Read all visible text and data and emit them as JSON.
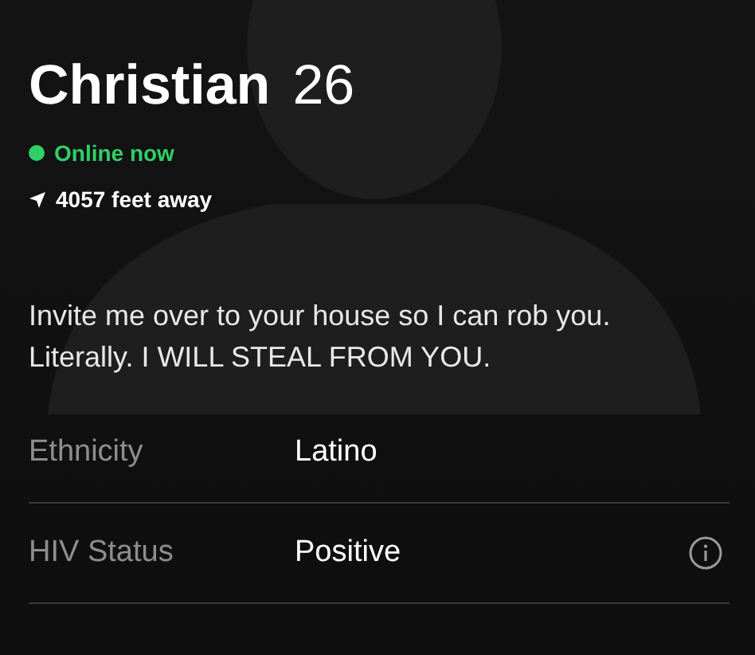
{
  "profile": {
    "name": "Christian",
    "age": "26",
    "online": true,
    "status": "Online now",
    "distance": "4057 feet away"
  },
  "bio": "Invite me over to your house so I can rob you. Literally. I WILL STEAL FROM YOU.",
  "details": [
    {
      "label": "Ethnicity",
      "value": "Latino",
      "info": false
    },
    {
      "label": "HIV Status",
      "value": "Positive",
      "info": true
    }
  ]
}
